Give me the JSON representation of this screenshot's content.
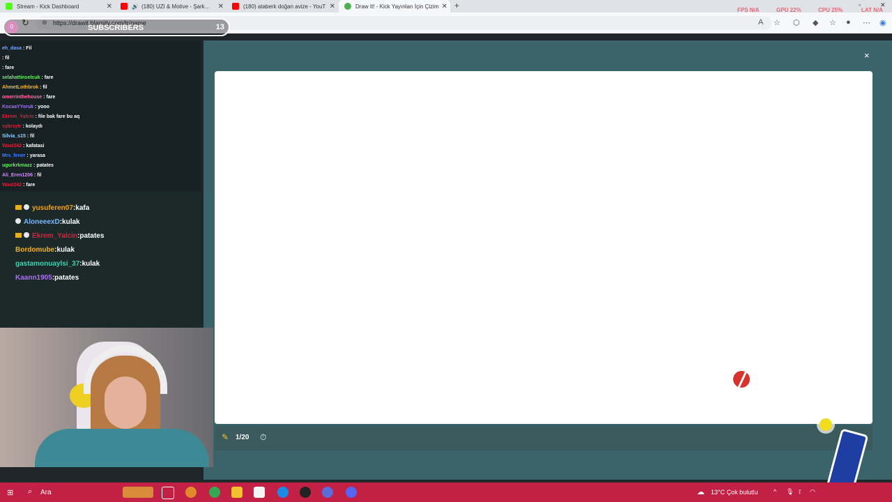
{
  "browser": {
    "tabs": [
      {
        "title": "Stream - Kick Dashboard",
        "icon": "kick-icon",
        "color": "#53fc18",
        "active": false
      },
      {
        "title": "(180) UZI & Motive - Şarkılar",
        "icon": "youtube-icon",
        "color": "#ff0000",
        "active": false
      },
      {
        "title": "(180) ataberk doğan avize - YouT",
        "icon": "youtube-icon",
        "color": "#ff0000",
        "active": false
      },
      {
        "title": "Draw It! - Kick Yayınları İçin Çizim",
        "icon": "drawit-icon",
        "color": "#4caf50",
        "active": true
      }
    ],
    "new_tab": "+",
    "url": "https://drawit.blamity.com/tr/game",
    "stats": {
      "fps_label": "FPS",
      "fps": "N/A",
      "gpu_label": "GPU",
      "gpu": "22%",
      "cpu_label": "CPU",
      "cpu": "25%",
      "lat_label": "LAT",
      "lat": "N/A"
    }
  },
  "overlay": {
    "subs_zero": "0",
    "subs_label": "SUBSCRIBERS",
    "subs_count": "13"
  },
  "chat_small": [
    {
      "user": "eh_dasa",
      "msg": "Fil",
      "color": "#7aa7ff"
    },
    {
      "user": "",
      "msg": "fil",
      "color": "#ffffff"
    },
    {
      "user": "",
      "msg": "fare",
      "color": "#ffffff"
    },
    {
      "user": "selahattinselcuk",
      "msg": "fare",
      "color": "#6ee86e"
    },
    {
      "user": "AhmetLothbrok",
      "msg": "fil",
      "color": "#f0b83a"
    },
    {
      "user": "omerrinthehouse",
      "msg": "fare",
      "color": "#ff6ea8"
    },
    {
      "user": "KocaaYYoruk",
      "msg": "yooo",
      "color": "#a36cff"
    },
    {
      "user": "Ekrem_Yalcin",
      "msg": "file bak fare bu aq",
      "color": "#d8223a"
    },
    {
      "user": "sybrsytr",
      "msg": "kolaydı",
      "color": "#d8223a"
    },
    {
      "user": "Silvia_s15",
      "msg": "fil",
      "color": "#9bd2ff"
    },
    {
      "user": "Waat242",
      "msg": "kafatasi",
      "color": "#d8223a"
    },
    {
      "user": "Mrs_fener",
      "msg": "yarasa",
      "color": "#3d7dff"
    },
    {
      "user": "ugurkrkmazz",
      "msg": "patates",
      "color": "#6ee86e"
    },
    {
      "user": "Ali_Eren1206",
      "msg": "fil",
      "color": "#d48cff"
    },
    {
      "user": "Waat242",
      "msg": "fare",
      "color": "#d8223a"
    }
  ],
  "chat_big": [
    {
      "user": "yusuferen07",
      "msg": "kafa",
      "color": "#f0a020",
      "crown": true,
      "cat": true
    },
    {
      "user": "AloneeexD",
      "msg": "kulak",
      "color": "#7ab8ff",
      "crown": false,
      "cat": true
    },
    {
      "user": "Ekrem_Yalcin",
      "msg": "patates",
      "color": "#d8223a",
      "crown": true,
      "cat": true
    },
    {
      "user": "Bordomube",
      "msg": "kulak",
      "color": "#f0b020",
      "crown": false,
      "cat": false
    },
    {
      "user": "gastamonuaylsi_37",
      "msg": "kulak",
      "color": "#3ed1b4",
      "crown": false,
      "cat": false
    },
    {
      "user": "Kaann1905",
      "msg": "patates",
      "color": "#b36bff",
      "crown": false,
      "cat": false
    }
  ],
  "game": {
    "close": "×",
    "round": "1/20",
    "pencil": "✎",
    "timer": "⏱"
  },
  "taskbar": {
    "search": "Ara",
    "weather": "13°C Çok bulutlu"
  }
}
